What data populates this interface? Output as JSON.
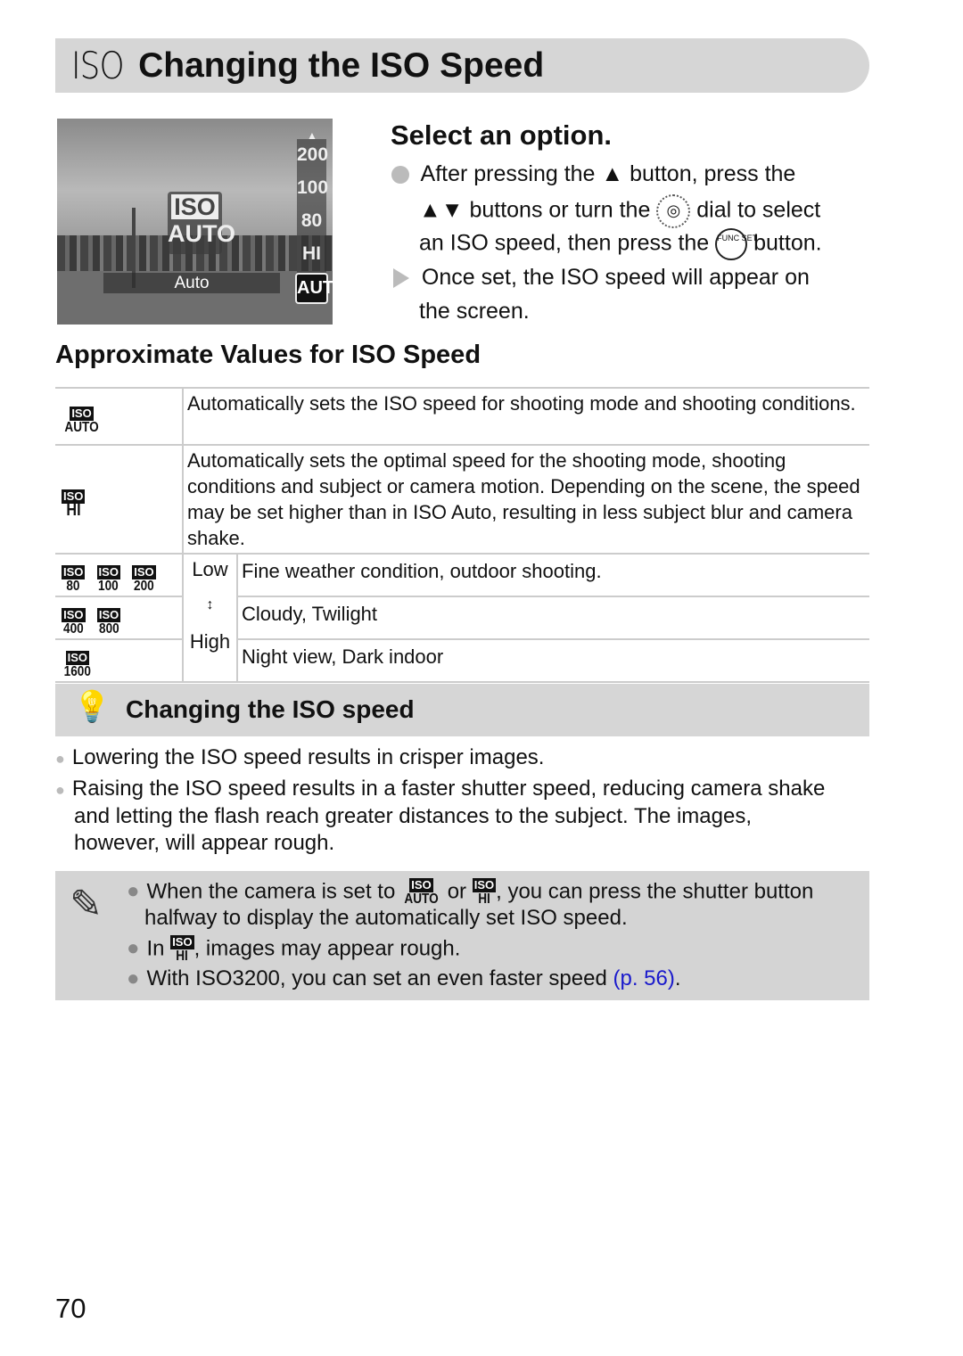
{
  "header": {
    "icon_text": "ISO",
    "title": "Changing the ISO Speed"
  },
  "photo": {
    "center_badge_top": "ISO",
    "center_badge_bottom": "AUTO",
    "mode_label": "Auto",
    "options": [
      "200",
      "100",
      "80",
      "HI"
    ],
    "selected_option": "AUTO"
  },
  "step": {
    "title": "Select an option.",
    "line1_a": "After pressing the",
    "line1_b": "button, press the",
    "line2_b": "buttons or turn the",
    "line2_c": "dial to select",
    "line3_a": "an ISO speed, then press the",
    "line3_b": "button.",
    "func_icon": "FUNC SET",
    "result_line1": "Once set, the ISO speed will appear on",
    "result_line2": "the screen."
  },
  "section_title": "Approximate Values for ISO Speed",
  "table": {
    "auto_desc": "Automatically sets the ISO speed for shooting mode and shooting conditions.",
    "hi_desc": "Automatically sets the optimal speed for the shooting mode, shooting conditions and subject or camera motion. Depending on the scene, the speed may be set higher than in ISO Auto, resulting in less subject blur and camera shake.",
    "low_label": "Low",
    "high_label": "High",
    "badge_label": "ISO",
    "rows": [
      {
        "values": [
          "80",
          "100",
          "200"
        ],
        "desc": "Fine weather condition, outdoor shooting."
      },
      {
        "values": [
          "400",
          "800"
        ],
        "desc": "Cloudy, Twilight"
      },
      {
        "values": [
          "1600"
        ],
        "desc": "Night view, Dark indoor"
      }
    ],
    "auto_value": "AUTO",
    "hi_value": "HI"
  },
  "tip": {
    "title": "Changing the ISO speed",
    "bullets": [
      "Lowering the ISO speed results in crisper images.",
      "Raising the ISO speed results in a faster shutter speed, reducing camera shake",
      "and letting the flash reach greater distances to the subject. The images,",
      "however, will appear rough."
    ]
  },
  "note": {
    "b1_a": "When the camera is set to",
    "b1_or": "or",
    "b1_b": ", you can press the shutter button",
    "b1_c": "halfway to display the automatically set ISO speed.",
    "b2_a": "In",
    "b2_b": ", images may appear rough.",
    "b3_a": "With ISO3200, you can set an even faster speed",
    "b3_link": "(p. 56)",
    "b3_end": "."
  },
  "page_number": "70",
  "colors": {
    "band": "#d6d6d6",
    "link": "#1a1acc"
  }
}
